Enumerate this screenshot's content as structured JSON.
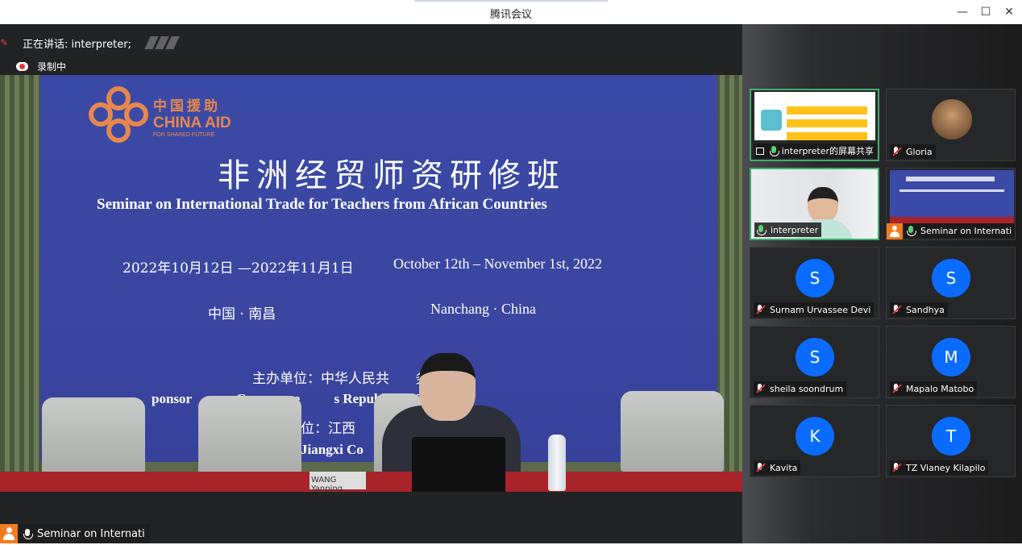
{
  "window": {
    "title": "腾讯会议",
    "minimize": "—",
    "maximize": "☐",
    "close": "✕"
  },
  "status": {
    "speaking_label": "正在讲话: interpreter;",
    "recording_label": "录制中"
  },
  "main_video": {
    "banner": {
      "logo_cn": "中国援助",
      "logo_en": "CHINA AID",
      "logo_sub": "FOR SHARED FUTURE",
      "title_zh": "非洲经贸师资研修班",
      "title_en": "Seminar on International Trade for Teachers from African Countries",
      "dates_zh": "2022年10月12日 —2022年11月1日",
      "dates_en": "October 12th – November 1st, 2022",
      "location_zh": "中国 · 南昌",
      "location_en": "Nanchang · China",
      "sponsor_zh": "主办单位：中华人民共      务部",
      "sponsor_en": "ponsor             Commerce          s Republic of China",
      "organizer_zh": "位：江西                     院",
      "organizer_en": "Jiangxi Co                     udies"
    },
    "nameplate": "WANG Yanping",
    "bottom_label": "Seminar on Internati"
  },
  "participants": [
    {
      "name": "interpreter的屏幕共享",
      "mic": "on",
      "type": "share",
      "active": true
    },
    {
      "name": "Gloria",
      "mic": "off",
      "type": "photo"
    },
    {
      "name": "interpreter",
      "mic": "on",
      "type": "video",
      "active": true
    },
    {
      "name": "Seminar on Internati",
      "mic": "on",
      "type": "video-host"
    },
    {
      "name": "Surnam Urvassee Devi",
      "mic": "off",
      "initial": "S"
    },
    {
      "name": "Sandhya",
      "mic": "off",
      "initial": "S"
    },
    {
      "name": "sheila soondrum",
      "mic": "off",
      "initial": "S"
    },
    {
      "name": "Mapalo Matobo",
      "mic": "off",
      "initial": "M"
    },
    {
      "name": "Kavita",
      "mic": "off",
      "initial": "K"
    },
    {
      "name": "TZ Vianey Kilapilo",
      "mic": "off",
      "initial": "T"
    }
  ],
  "colors": {
    "accent_green": "#3cb06a",
    "avatar_blue": "#0a6cff",
    "host_orange": "#f27b1e",
    "mic_muted_red": "#e23b3b"
  }
}
